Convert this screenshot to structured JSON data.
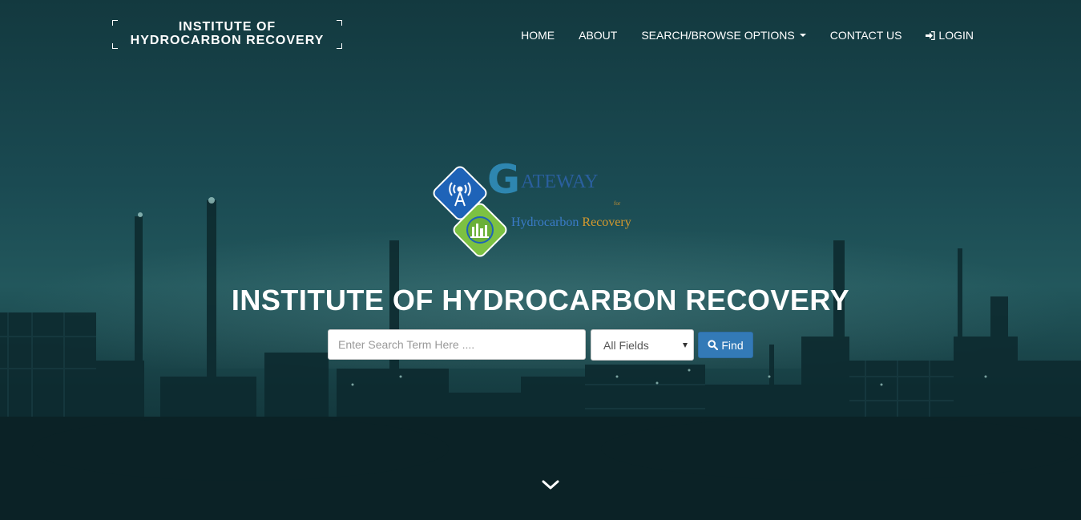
{
  "brand": {
    "line1": "INSTITUTE OF",
    "line2": "HYDROCARBON RECOVERY"
  },
  "nav": {
    "home": "HOME",
    "about": "ABOUT",
    "search_browse": "SEARCH/BROWSE OPTIONS",
    "contact": "CONTACT US",
    "login": "LOGIN"
  },
  "logo": {
    "gateway_g": "G",
    "gateway_rest": "ATEWAY",
    "for": "for",
    "hydrocarbon": "Hydrocarbon",
    "recovery": "Recovery"
  },
  "hero": {
    "title": "INSTITUTE OF HYDROCARBON RECOVERY"
  },
  "search": {
    "placeholder": "Enter Search Term Here ....",
    "field_selected": "All Fields",
    "find_label": "Find"
  },
  "icons": {
    "dropdown": "caret-down-icon",
    "login": "sign-in-icon",
    "find": "search-icon",
    "scroll": "chevron-down-icon"
  },
  "colors": {
    "find_button": "#337ab7",
    "logo_blue": "#1e63b8",
    "logo_green": "#7cc142",
    "logo_orange": "#d69a2e"
  }
}
